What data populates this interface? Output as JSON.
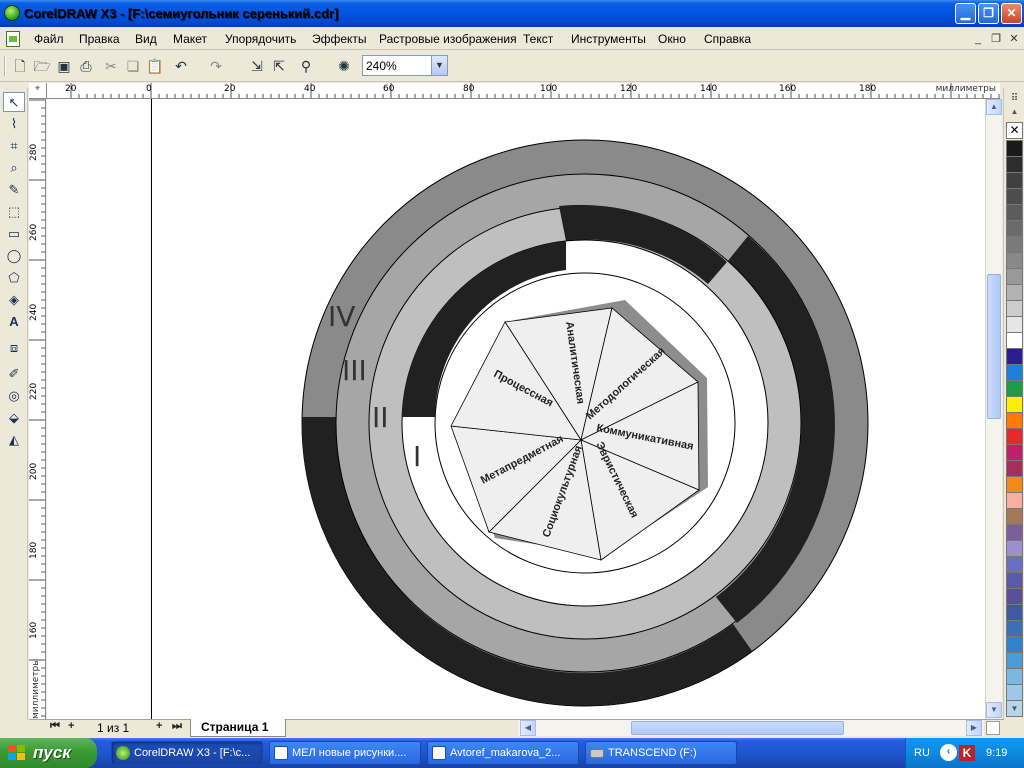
{
  "window": {
    "title": "CorelDRAW X3 - [F:\\семиугольник серенький.cdr]",
    "minimize_icon": "minimize-icon",
    "restore_icon": "restore-icon",
    "close_icon": "close-icon",
    "minimize_glyph": "▁",
    "restore_glyph": "❐",
    "close_glyph": "✕"
  },
  "menu": {
    "items": [
      "Файл",
      "Правка",
      "Вид",
      "Макет",
      "Упорядочить",
      "Эффекты",
      "Растровые изображения",
      "Текст",
      "Инструменты",
      "Окно",
      "Справка"
    ],
    "mdi_minimize": "_",
    "mdi_restore": "❐",
    "mdi_close": "✕"
  },
  "toolbar": {
    "zoom": "240%",
    "zoom_arrow": "▼",
    "buttons": [
      {
        "icon": "new-document-icon",
        "glyph": "🗋"
      },
      {
        "icon": "open-icon",
        "glyph": "🗁"
      },
      {
        "icon": "save-icon",
        "glyph": "▣"
      },
      {
        "icon": "print-icon",
        "glyph": "⎙"
      },
      {
        "icon": "cut-icon",
        "glyph": "✂"
      },
      {
        "icon": "copy-icon",
        "glyph": "❏"
      },
      {
        "icon": "paste-icon",
        "glyph": "📋"
      },
      {
        "icon": "undo-icon",
        "glyph": "↶"
      },
      {
        "icon": "redo-icon",
        "glyph": "↷"
      },
      {
        "icon": "import-icon",
        "glyph": "⇲"
      },
      {
        "icon": "export-icon",
        "glyph": "⇱"
      },
      {
        "icon": "application-launcher-icon",
        "glyph": "⚲"
      },
      {
        "icon": "welcome-screen-icon",
        "glyph": "✺"
      }
    ]
  },
  "toolbox": [
    {
      "icon": "pick-tool-icon",
      "glyph": "↖"
    },
    {
      "icon": "shape-tool-icon",
      "glyph": "⌇"
    },
    {
      "icon": "crop-tool-icon",
      "glyph": "⌗"
    },
    {
      "icon": "zoom-tool-icon",
      "glyph": "⌕"
    },
    {
      "icon": "freehand-tool-icon",
      "glyph": "✎"
    },
    {
      "icon": "smart-fill-tool-icon",
      "glyph": "⬚"
    },
    {
      "icon": "rectangle-tool-icon",
      "glyph": "▭"
    },
    {
      "icon": "ellipse-tool-icon",
      "glyph": "◯"
    },
    {
      "icon": "polygon-tool-icon",
      "glyph": "⬠"
    },
    {
      "icon": "basic-shapes-tool-icon",
      "glyph": "◈"
    },
    {
      "icon": "text-tool-icon",
      "glyph": "A"
    },
    {
      "icon": "interactive-blend-tool-icon",
      "glyph": "⧈"
    },
    {
      "icon": "eyedropper-tool-icon",
      "glyph": "✐"
    },
    {
      "icon": "outline-tool-icon",
      "glyph": "◎"
    },
    {
      "icon": "fill-tool-icon",
      "glyph": "⬙"
    },
    {
      "icon": "interactive-fill-tool-icon",
      "glyph": "◭"
    }
  ],
  "rulers": {
    "unit": "миллиметры",
    "h_labels": [
      "20",
      "0",
      "20",
      "40",
      "60",
      "80",
      "100",
      "120",
      "140",
      "160",
      "180"
    ],
    "v_labels": [
      "280",
      "260",
      "240",
      "220",
      "200",
      "180",
      "160"
    ]
  },
  "diagram": {
    "rings": [
      "IV",
      "III",
      "II",
      "I"
    ],
    "segments": [
      "Аналитическая",
      "Методологическая",
      "Коммуникативная",
      "Эвристическая",
      "Социокультурная",
      "Метапредметная",
      "Процессная"
    ]
  },
  "palette": {
    "no_color_glyph": "✕",
    "up_arrow": "▲",
    "down_arrow": "▼",
    "colors": [
      "#1a1a1a",
      "#2d2d2d",
      "#404040",
      "#4d4d4d",
      "#5c5c5c",
      "#6b6b6b",
      "#7a7a7a",
      "#898989",
      "#999999",
      "#b3b3b3",
      "#cccccc",
      "#e6e6e6",
      "#ffffff",
      "#2d1e8f",
      "#1d7fd8",
      "#1f9a4a",
      "#ffef00",
      "#ff7a00",
      "#e8282b",
      "#c0206a",
      "#a3305a",
      "#f08a1a",
      "#f7b0a0",
      "#a27a5a",
      "#7a5f98",
      "#9b8fcf",
      "#6b6fbf",
      "#5a5aa8",
      "#5a4f9b",
      "#3f5aa3",
      "#3b6fb6",
      "#2f84c8",
      "#4b9bd8",
      "#7ab7e4",
      "#9fc8e8",
      "#b6d5ec"
    ]
  },
  "scrollbars": {
    "up": "▲",
    "down": "▼",
    "left": "◀",
    "right": "▶"
  },
  "page_tabs": {
    "first": "⏮",
    "prev_add": "+",
    "count": "1 из 1",
    "next_add": "+",
    "last": "⏭",
    "current_tab": "Страница 1"
  },
  "taskbar": {
    "start": "пуск",
    "tasks": [
      "CorelDRAW X3 - [F:\\c...",
      "МЕЛ новые рисунки....",
      "Avtoref_makarova_2...",
      "TRANSCEND (F:)"
    ],
    "language": "RU",
    "time": "9:19",
    "tray_arrow": "‹",
    "kaspersky_glyph": "K"
  }
}
